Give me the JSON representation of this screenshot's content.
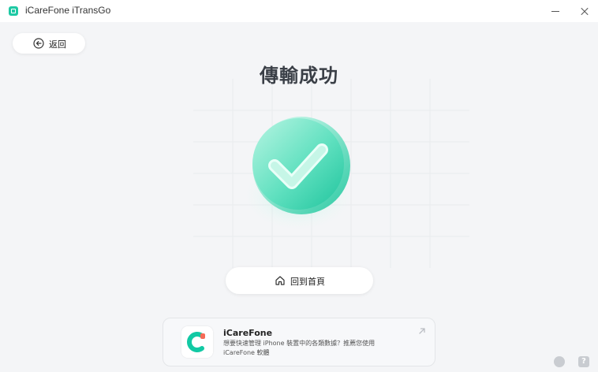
{
  "window": {
    "title": "iCareFone iTransGo",
    "icons": {
      "app": "app-logo-icon",
      "minimize": "minimize-icon",
      "close": "close-icon"
    }
  },
  "back": {
    "label": "返回",
    "icon": "back-arrow-icon"
  },
  "page": {
    "title": "傳輸成功"
  },
  "success": {
    "icon": "checkmark-success-icon",
    "accent": "#2ed3ad"
  },
  "home": {
    "label": "回到首頁",
    "icon": "home-icon"
  },
  "promo": {
    "title": "iCareFone",
    "description": "想要快速管理 iPhone 裝置中的各類數據？推薦您使用 iCareFone 軟體",
    "logo_icon": "icarefone-logo-icon",
    "arrow_icon": "external-arrow-icon"
  },
  "footer": {
    "chat_icon": "chat-icon",
    "help_label": "?"
  },
  "colors": {
    "accent": "#1ec9a4",
    "background": "#f4f5f7"
  }
}
